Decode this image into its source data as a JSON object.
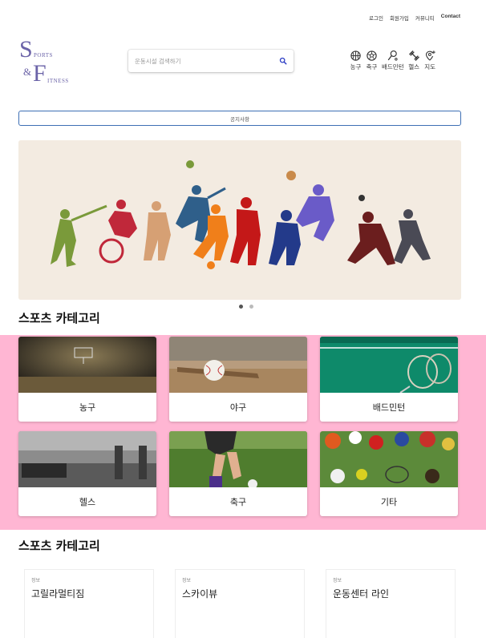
{
  "header": {
    "links": {
      "login": "로그인",
      "signup": "회원가입",
      "community": "커뮤니티",
      "contact": "Contact"
    },
    "logo": {
      "s_letter": "S",
      "s_rest": "PORTS",
      "ampersand": "&",
      "f_letter": "F",
      "f_rest": "ITNESS",
      "color": "#6b63a8"
    },
    "search": {
      "placeholder": "운동시설 검색하기",
      "value": ""
    },
    "categories": [
      {
        "label": "농구",
        "icon": "basketball-icon"
      },
      {
        "label": "축구",
        "icon": "soccer-ball-icon"
      },
      {
        "label": "배드민턴",
        "icon": "shuttlecock-icon"
      },
      {
        "label": "헬스",
        "icon": "dumbbell-icon"
      },
      {
        "label": "지도",
        "icon": "map-pin-icon"
      }
    ]
  },
  "notice": {
    "label": "공지사항",
    "border_color": "#3d6fb4"
  },
  "carousel": {
    "slide_count": 2,
    "active_index": 0
  },
  "sports_section": {
    "title": "스포츠 카테고리",
    "background": "#ffb6d3",
    "cards": [
      {
        "label": "농구"
      },
      {
        "label": "야구"
      },
      {
        "label": "배드민턴"
      },
      {
        "label": "헬스"
      },
      {
        "label": "축구"
      },
      {
        "label": "기타"
      }
    ]
  },
  "info_section": {
    "title": "스포츠 카테고리",
    "cards": [
      {
        "tag": "정보",
        "name": "고릴라멀티짐"
      },
      {
        "tag": "정보",
        "name": "스카이뷰"
      },
      {
        "tag": "정보",
        "name": "운동센터 라인"
      }
    ]
  }
}
